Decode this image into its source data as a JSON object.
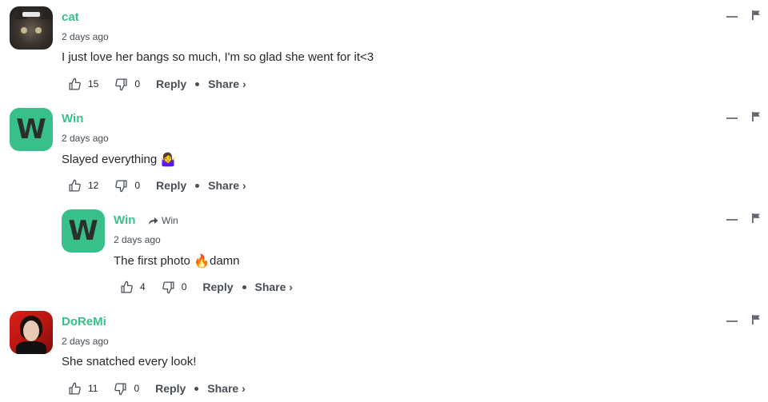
{
  "comments": [
    {
      "author": "cat",
      "timestamp": "2 days ago",
      "text": "I just love her bangs so much, I'm so glad she went for it<3",
      "likes": "15",
      "dislikes": "0",
      "reply_label": "Reply",
      "share_label": "Share ›"
    },
    {
      "author": "Win",
      "avatar_letter": "W",
      "timestamp": "2 days ago",
      "text": "Slayed everything",
      "emoji": "🤷‍♀️",
      "likes": "12",
      "dislikes": "0",
      "reply_label": "Reply",
      "share_label": "Share ›"
    },
    {
      "author": "Win",
      "avatar_letter": "W",
      "reply_to": "Win",
      "timestamp": "2 days ago",
      "text_before": "The first photo ",
      "emoji": "🔥",
      "text_after": "damn",
      "likes": "4",
      "dislikes": "0",
      "reply_label": "Reply",
      "share_label": "Share ›"
    },
    {
      "author": "DoReMi",
      "timestamp": "2 days ago",
      "text": "She snatched every look!",
      "likes": "11",
      "dislikes": "0",
      "reply_label": "Reply",
      "share_label": "Share ›"
    }
  ],
  "icons": [
    "thumbs-up-icon",
    "thumbs-down-icon",
    "collapse-icon",
    "flag-icon",
    "reply-arrow-icon"
  ],
  "colors": {
    "accent": "#39c08a",
    "text": "#26282a",
    "muted": "#464e56"
  }
}
